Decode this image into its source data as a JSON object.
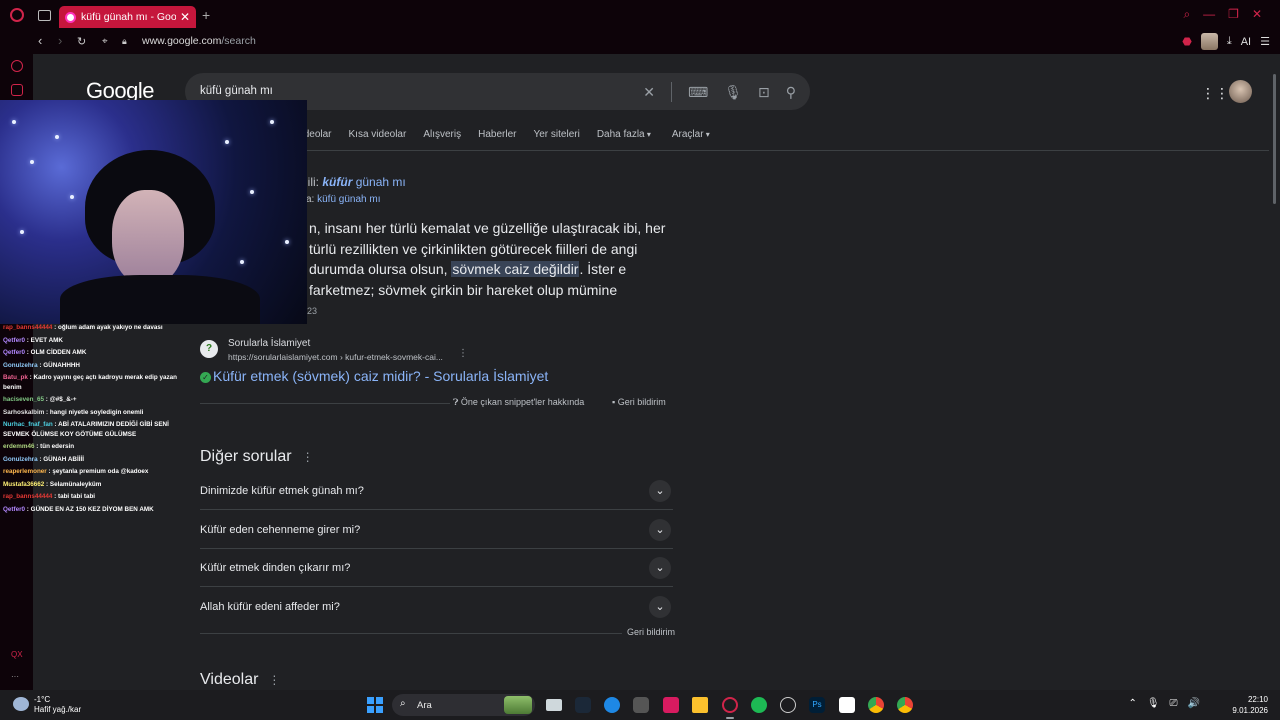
{
  "browser": {
    "tab_title": "küfü günah mı - Google",
    "tab_close": "✕",
    "new_tab": "+",
    "url_host": "www.google.com",
    "url_path": "/search",
    "ai_label": "AI",
    "window_controls": [
      "⌕",
      "—",
      "❐",
      "✕"
    ],
    "nav_back": "‹",
    "nav_forward": "›",
    "nav_reload": "↻",
    "sidebar_badge": "QX",
    "sidebar_more": "···"
  },
  "google": {
    "logo": "Google",
    "query": "küfü günah mı",
    "clear": "✕",
    "filters": [
      "Videolar",
      "Kısa videolar",
      "Alışveriş",
      "Haberler",
      "Yer siteleri"
    ],
    "more_filter": "Daha fazla",
    "tools_filter": "Araçlar",
    "related_prefix": "İlgili:",
    "related_bold": "küfür",
    "related_rest": "günah mı",
    "related_line2_prefix": "a:",
    "related_line2_link": "küfü günah mı",
    "snippet_before": "n, insanı her türlü kemalat ve güzelliğe ulaştıracak ibi, her türlü rezillikten ve çirkinlikten götürecek fiilleri de angi durumda olursa olsun,",
    "snippet_highlight": "sövmek caiz değildir",
    "snippet_after": ". İster e farketmez; sövmek çirkin bir hareket olup mümine",
    "snippet_date": "23",
    "source_name": "Sorularla İslamiyet",
    "source_url": "https://sorularlaislamiyet.com › kufur-etmek-sovmek-cai...",
    "source_more": "⋮",
    "result_title": "Küfür etmek (sövmek) caiz midir? - Sorularla İslamiyet",
    "about_snippets": "Öne çıkan snippet'ler hakkında",
    "feedback": "Geri bildirim",
    "paa_title": "Diğer sorular",
    "paa_dots": "⋮",
    "paa_questions": [
      "Dinimizde küfür etmek günah mı?",
      "Küfür eden cehenneme girer mi?",
      "Küfür etmek dinden çıkarır mı?",
      "Allah küfür edeni affeder mi?"
    ],
    "paa_chevron": "⌄",
    "feedback2": "Geri bildirim",
    "videos_title": "Videolar",
    "videos_dots": "⋮"
  },
  "chat": [
    {
      "user": "rap_banns44444",
      "text": "oğlum adam ayak yakıyo ne davası",
      "color": "#e53935"
    },
    {
      "user": "Qetfer0",
      "text": "EVET AMK",
      "color": "#b388ff"
    },
    {
      "user": "Qetfer0",
      "text": "OLM CİDDEN AMK",
      "color": "#b388ff"
    },
    {
      "user": "Gonulzehra",
      "text": "GÜNAHHHH",
      "color": "#90caf9"
    },
    {
      "user": "Batu_pk",
      "text": "Kadro yayını geç açtı kadroyu merak edip yazan benim",
      "color": "#f06292"
    },
    {
      "user": "haciseven_65",
      "text": "@#$_&-+",
      "color": "#81c784"
    },
    {
      "user": "Sarhoskalbim",
      "text": "hangi niyetle soyledigin onemli",
      "color": "#e0e0e0"
    },
    {
      "user": "Nurhac_fnaf_fan",
      "text": "ABİ ATALARIMIZIN DEDİĞİ GİBİ SENİ SEVMEK ÖLÜMSE KOY GÖTÜME GÜLÜMSE",
      "color": "#4dd0e1"
    },
    {
      "user": "erdemm46",
      "text": "tün edersin",
      "color": "#aed581"
    },
    {
      "user": "Gonulzehra",
      "text": "GÜNAH ABİİİİ",
      "color": "#90caf9"
    },
    {
      "user": "reaperlemoner",
      "text": "şeytanla premium oda @kadoex",
      "color": "#ffb74d"
    },
    {
      "user": "Mustafa36662",
      "text": "Selamünaleyküm",
      "color": "#fff176"
    },
    {
      "user": "rap_banns44444",
      "text": "tabi tabi tabi",
      "color": "#e53935"
    },
    {
      "user": "Qetfer0",
      "text": "GÜNDE EN AZ 150 KEZ DİYOM BEN AMK",
      "color": "#b388ff"
    }
  ],
  "taskbar": {
    "weather_temp": "-1°C",
    "weather_cond": "Hafif yağ./kar",
    "search_label": "Ara",
    "search_icon": "⌕",
    "tray_icons": [
      "⌃",
      "🎙",
      "⎚",
      "🔊"
    ],
    "time": "22:10",
    "date": "9.01.2026"
  }
}
